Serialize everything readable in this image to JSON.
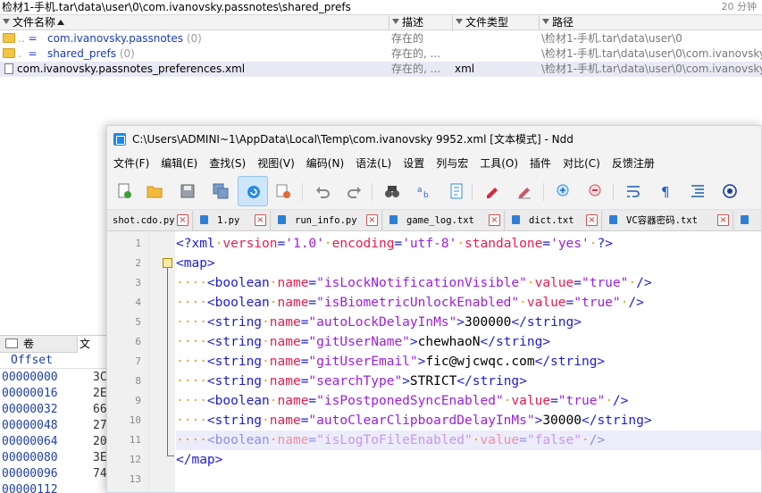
{
  "explorer": {
    "path": "检材1-手机.tar\\data\\user\\0\\com.ivanovsky.passnotes\\shared_prefs",
    "count": "20 分钟",
    "headers": {
      "name": "文件名称",
      "desc": "描述",
      "type": "文件类型",
      "path": "路径"
    },
    "rows": [
      {
        "eq": "=",
        "name": "com.ivanovsky.passnotes",
        "num": "(0)",
        "desc": "存在的",
        "type": "",
        "path": "\\检材1-手机.tar\\data\\user\\0"
      },
      {
        "eq": "=",
        "name": "shared_prefs",
        "num": "(0)",
        "desc": "存在的, ...",
        "type": "",
        "path": "\\检材1-手机.tar\\data\\user\\0\\com.ivanovsky.passnotes"
      },
      {
        "name": "com.ivanovsky.passnotes_preferences.xml",
        "desc": "存在的, ...",
        "type": "xml",
        "path": "\\检材1-手机.tar\\data\\user\\0\\com.ivanovsky.passnotes\\shared_prefs"
      }
    ],
    "left_tabs": {
      "tab1": "卷",
      "tab2": "文"
    },
    "hex_header": "Offset",
    "hex_rows": [
      {
        "offset": "00000000",
        "val": "3C"
      },
      {
        "offset": "00000016",
        "val": "2E"
      },
      {
        "offset": "00000032",
        "val": "66"
      },
      {
        "offset": "00000048",
        "val": "27"
      },
      {
        "offset": "00000064",
        "val": "20"
      },
      {
        "offset": "00000080",
        "val": "3E"
      },
      {
        "offset": "00000096",
        "val": "74"
      },
      {
        "offset": "00000112",
        "val": ""
      }
    ]
  },
  "editor_window": {
    "title": "C:\\Users\\ADMINI~1\\AppData\\Local\\Temp\\com.ivanovsky 9952.xml [文本模式] - Ndd",
    "menu": [
      "文件(F)",
      "编辑(E)",
      "查找(S)",
      "视图(V)",
      "编码(N)",
      "语法(L)",
      "设置",
      "列与宏",
      "工具(O)",
      "插件",
      "对比(C)",
      "反馈注册"
    ],
    "toolbar_icons": [
      "new-file-icon",
      "open-folder-icon",
      "save-icon",
      "save-all-icon",
      "reload-icon",
      "close-file-icon",
      "undo-icon",
      "redo-icon",
      "binoculars-icon",
      "replace-icon",
      "bookmark-icon",
      "red-marker-icon",
      "clear-marker-icon",
      "zoom-in-icon",
      "zoom-out-icon",
      "word-wrap-icon",
      "pilcrow-icon",
      "indent-guide-icon",
      "target-icon"
    ],
    "tabs": [
      {
        "label": "shot.cdo.py"
      },
      {
        "label": "1.py"
      },
      {
        "label": "run_info.py"
      },
      {
        "label": "game_log.txt"
      },
      {
        "label": "dict.txt"
      },
      {
        "label": "VC容器密码.txt"
      }
    ],
    "lines": [
      {
        "n": "1",
        "parts": [
          [
            "tg",
            "<?xml"
          ],
          [
            "dt",
            "·"
          ],
          [
            "at",
            "version"
          ],
          [
            "tg",
            "="
          ],
          [
            "vl",
            "'1.0'"
          ],
          [
            "dt",
            "·"
          ],
          [
            "at",
            "encoding"
          ],
          [
            "tg",
            "="
          ],
          [
            "vl",
            "'utf-8'"
          ],
          [
            "dt",
            "·"
          ],
          [
            "at",
            "standalone"
          ],
          [
            "tg",
            "="
          ],
          [
            "vl",
            "'yes'"
          ],
          [
            "dt",
            "·"
          ],
          [
            "tg",
            "?>"
          ]
        ]
      },
      {
        "n": "2",
        "parts": [
          [
            "tg",
            "<map>"
          ]
        ]
      },
      {
        "n": "3",
        "parts": [
          [
            "dt",
            "····"
          ],
          [
            "tg",
            "<boolean"
          ],
          [
            "dt",
            "·"
          ],
          [
            "at",
            "name"
          ],
          [
            "tg",
            "="
          ],
          [
            "vl",
            "\"isLockNotificationVisible\""
          ],
          [
            "dt",
            "·"
          ],
          [
            "at",
            "value"
          ],
          [
            "tg",
            "="
          ],
          [
            "vl",
            "\"true\""
          ],
          [
            "dt",
            "·"
          ],
          [
            "tg",
            "/>"
          ]
        ]
      },
      {
        "n": "4",
        "parts": [
          [
            "dt",
            "····"
          ],
          [
            "tg",
            "<boolean"
          ],
          [
            "dt",
            "·"
          ],
          [
            "at",
            "name"
          ],
          [
            "tg",
            "="
          ],
          [
            "vl",
            "\"isBiometricUnlockEnabled\""
          ],
          [
            "dt",
            "·"
          ],
          [
            "at",
            "value"
          ],
          [
            "tg",
            "="
          ],
          [
            "vl",
            "\"true\""
          ],
          [
            "dt",
            "·"
          ],
          [
            "tg",
            "/>"
          ]
        ]
      },
      {
        "n": "5",
        "parts": [
          [
            "dt",
            "····"
          ],
          [
            "tg",
            "<string"
          ],
          [
            "dt",
            "·"
          ],
          [
            "at",
            "name"
          ],
          [
            "tg",
            "="
          ],
          [
            "vl",
            "\"autoLockDelayInMs\""
          ],
          [
            "tg",
            ">"
          ],
          [
            "tx",
            "300000"
          ],
          [
            "tg",
            "</string>"
          ]
        ]
      },
      {
        "n": "6",
        "parts": [
          [
            "dt",
            "····"
          ],
          [
            "tg",
            "<string"
          ],
          [
            "dt",
            "·"
          ],
          [
            "at",
            "name"
          ],
          [
            "tg",
            "="
          ],
          [
            "vl",
            "\"gitUserName\""
          ],
          [
            "tg",
            ">"
          ],
          [
            "tx",
            "chewhaoN"
          ],
          [
            "tg",
            "</string>"
          ]
        ]
      },
      {
        "n": "7",
        "parts": [
          [
            "dt",
            "····"
          ],
          [
            "tg",
            "<string"
          ],
          [
            "dt",
            "·"
          ],
          [
            "at",
            "name"
          ],
          [
            "tg",
            "="
          ],
          [
            "vl",
            "\"gitUserEmail\""
          ],
          [
            "tg",
            ">"
          ],
          [
            "tx",
            "fic@wjcwqc.com"
          ],
          [
            "tg",
            "</string>"
          ]
        ]
      },
      {
        "n": "8",
        "parts": [
          [
            "dt",
            "····"
          ],
          [
            "tg",
            "<string"
          ],
          [
            "dt",
            "·"
          ],
          [
            "at",
            "name"
          ],
          [
            "tg",
            "="
          ],
          [
            "vl",
            "\"searchType\""
          ],
          [
            "tg",
            ">"
          ],
          [
            "tx",
            "STRICT"
          ],
          [
            "tg",
            "</string>"
          ]
        ]
      },
      {
        "n": "9",
        "parts": [
          [
            "dt",
            "····"
          ],
          [
            "tg",
            "<boolean"
          ],
          [
            "dt",
            "·"
          ],
          [
            "at",
            "name"
          ],
          [
            "tg",
            "="
          ],
          [
            "vl",
            "\"isPostponedSyncEnabled\""
          ],
          [
            "dt",
            "·"
          ],
          [
            "at",
            "value"
          ],
          [
            "tg",
            "="
          ],
          [
            "vl",
            "\"true\""
          ],
          [
            "dt",
            "·"
          ],
          [
            "tg",
            "/>"
          ]
        ]
      },
      {
        "n": "10",
        "parts": [
          [
            "dt",
            "····"
          ],
          [
            "tg",
            "<string"
          ],
          [
            "dt",
            "·"
          ],
          [
            "at",
            "name"
          ],
          [
            "tg",
            "="
          ],
          [
            "vl",
            "\"autoClearClipboardDelayInMs\""
          ],
          [
            "tg",
            ">"
          ],
          [
            "tx",
            "30000"
          ],
          [
            "tg",
            "</string>"
          ]
        ]
      },
      {
        "n": "11",
        "current": true,
        "parts": [
          [
            "dt",
            "····"
          ],
          [
            "tg",
            "<boolean"
          ],
          [
            "dt",
            "·"
          ],
          [
            "at",
            "name"
          ],
          [
            "tg",
            "="
          ],
          [
            "vl",
            "\"isLogToFileEnabled\""
          ],
          [
            "dt",
            "·"
          ],
          [
            "at",
            "value"
          ],
          [
            "tg",
            "="
          ],
          [
            "vl",
            "\"false\""
          ],
          [
            "dt",
            "·"
          ],
          [
            "tg",
            "/>"
          ]
        ]
      },
      {
        "n": "12",
        "parts": [
          [
            "tg",
            "</map>"
          ]
        ]
      },
      {
        "n": "13",
        "parts": []
      }
    ]
  }
}
